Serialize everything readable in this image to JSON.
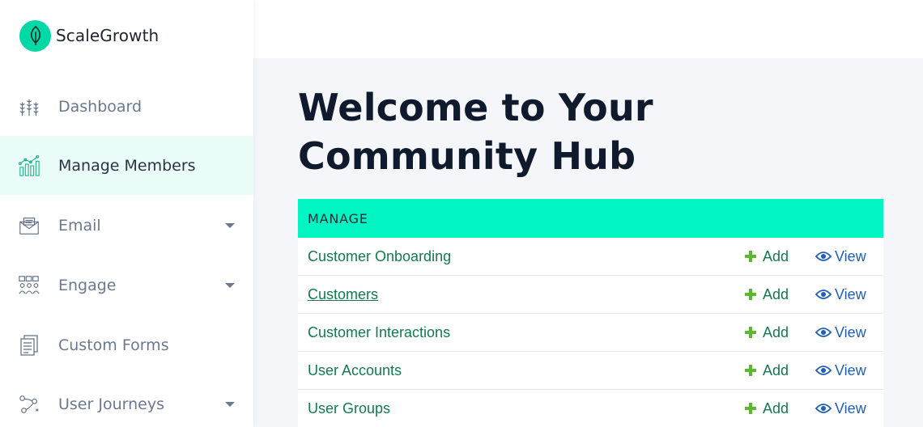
{
  "brand": {
    "name": "ScaleGrowth",
    "logo_icon": "leaf-icon",
    "accent_color": "#00d9a6"
  },
  "sidebar": {
    "items": [
      {
        "label": "Dashboard",
        "icon": "wheat-icon",
        "has_submenu": false,
        "active": false
      },
      {
        "label": "Manage Members",
        "icon": "bar-chart-icon",
        "has_submenu": false,
        "active": true
      },
      {
        "label": "Email",
        "icon": "envelope-icon",
        "has_submenu": true,
        "active": false
      },
      {
        "label": "Engage",
        "icon": "people-icon",
        "has_submenu": true,
        "active": false
      },
      {
        "label": "Custom Forms",
        "icon": "forms-icon",
        "has_submenu": false,
        "active": false
      },
      {
        "label": "User Journeys",
        "icon": "journey-icon",
        "has_submenu": true,
        "active": false
      }
    ]
  },
  "main": {
    "title": "Welcome to Your Community Hub",
    "table": {
      "header": "MANAGE",
      "header_color": "#00f5c3",
      "add_label": "Add",
      "view_label": "View",
      "rows": [
        {
          "label": "Customer Onboarding"
        },
        {
          "label": "Customers"
        },
        {
          "label": "Customer Interactions"
        },
        {
          "label": "User Accounts"
        },
        {
          "label": "User Groups"
        }
      ]
    }
  }
}
